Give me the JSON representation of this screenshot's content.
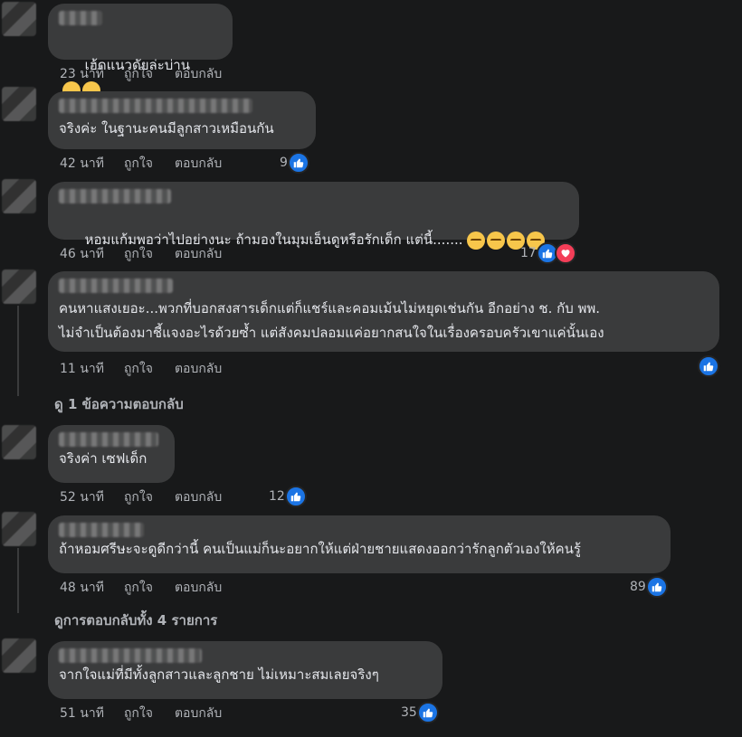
{
  "colors": {
    "background": "#18191a",
    "bubble": "#3a3b3c",
    "like": "#1b74e4",
    "love": "#f33e58"
  },
  "actions": {
    "like_label": "ถูกใจ",
    "reply_label": "ตอบกลับ"
  },
  "comments": [
    {
      "text": "เฮ้ดแนวดัยล่ะบ่าน",
      "emojis": [
        "laughing-crying",
        "laughing-crying"
      ],
      "time": "23 นาที",
      "reactions": null
    },
    {
      "text": "จริงค่ะ ในฐานะคนมีลูกสาวเหมือนกัน",
      "time": "42 นาที",
      "reactions": {
        "count": "9",
        "types": [
          "like"
        ]
      }
    },
    {
      "name_partial": "...ๆะ ใจคุณนนพนุล",
      "text": "หอมแก้มพอว่าไปอย่างนะ ถ้ามองในมุมเอ็นดูหรือรักเด็ก แต่นี้.......",
      "emojis": [
        "sleepy",
        "sleepy",
        "sleepy",
        "sleepy"
      ],
      "time": "46 นาที",
      "reactions": {
        "count": "17",
        "types": [
          "like",
          "love"
        ]
      }
    },
    {
      "text_line1": "คนหาแสงเยอะ...พวกที่บอกสงสารเด็กแต่ก็แชร์และคอมเม้นไม่หยุดเช่นกัน อีกอย่าง ช. กับ พพ.",
      "text_line2": "ไม่จำเป็นต้องมาชี้แจงอะไรด้วยซ้ำ แต่สังคมปลอมแค่อยากสนใจในเรื่องครอบครัวเขาแค่นั้นเอง",
      "time": "11 นาที",
      "reactions": {
        "count": "",
        "types": [
          "like"
        ]
      },
      "view_replies": "ดู 1 ข้อความตอบกลับ"
    },
    {
      "text": "จริงค่า เซฟเด็ก",
      "time": "52 นาที",
      "reactions": {
        "count": "12",
        "types": [
          "like"
        ]
      }
    },
    {
      "text": "ถ้าหอมศรีษะจะดูดีกว่านี้ คนเป็นแม่ก็นะอยากให้แต่ฝ่ายชายแสดงออกว่ารักลูกตัวเองให้คนรู้",
      "time": "48 นาที",
      "reactions": {
        "count": "89",
        "types": [
          "like"
        ]
      },
      "view_replies": "ดูการตอบกลับทั้ง 4 รายการ"
    },
    {
      "text": "จากใจแม่ที่มีทั้งลูกสาวและลูกชาย ไม่เหมาะสมเลยจริงๆ",
      "time": "51 นาที",
      "reactions": {
        "count": "35",
        "types": [
          "like"
        ]
      }
    }
  ]
}
